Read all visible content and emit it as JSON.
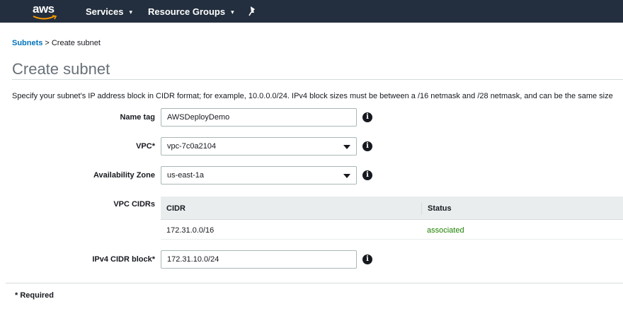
{
  "nav": {
    "logo_text": "aws",
    "services_label": "Services",
    "resource_groups_label": "Resource Groups",
    "caret": "▾"
  },
  "breadcrumb": {
    "parent": "Subnets",
    "separator": ">",
    "current": "Create subnet"
  },
  "page": {
    "title": "Create subnet",
    "description": "Specify your subnet's IP address block in CIDR format; for example, 10.0.0.0/24. IPv4 block sizes must be between a /16 netmask and /28 netmask, and can be the same size"
  },
  "form": {
    "name_tag": {
      "label": "Name tag",
      "value": "AWSDeployDemo"
    },
    "vpc": {
      "label": "VPC*",
      "value": "vpc-7c0a2104"
    },
    "availability_zone": {
      "label": "Availability Zone",
      "value": "us-east-1a"
    },
    "vpc_cidrs": {
      "label": "VPC CIDRs",
      "columns": [
        "CIDR",
        "Status"
      ],
      "rows": [
        {
          "cidr": "172.31.0.0/16",
          "status": "associated"
        }
      ]
    },
    "ipv4_cidr": {
      "label": "IPv4 CIDR block*",
      "value": "172.31.10.0/24"
    },
    "info_glyph": "i"
  },
  "footer": {
    "required_note": "* Required"
  },
  "colors": {
    "nav_bg": "#232f3e",
    "link": "#0073bb",
    "status_ok": "#1d8102",
    "aws_orange": "#ff9900"
  }
}
